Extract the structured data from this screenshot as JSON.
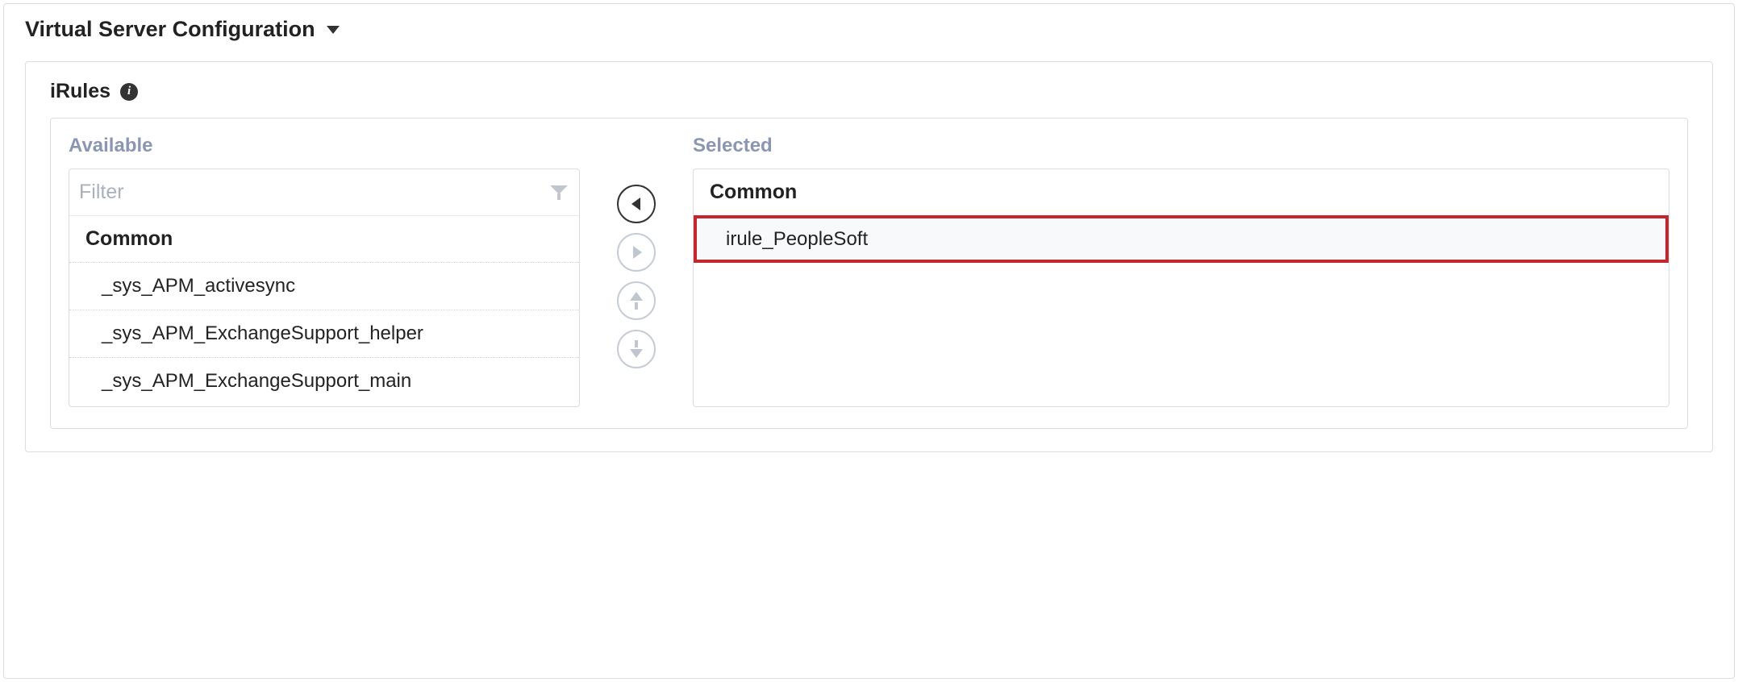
{
  "panel": {
    "title": "Virtual Server Configuration"
  },
  "section": {
    "label": "iRules"
  },
  "dualList": {
    "availableTitle": "Available",
    "selectedTitle": "Selected",
    "filterPlaceholder": "Filter",
    "groupHeader": "Common",
    "availableItems": {
      "0": "_sys_APM_activesync",
      "1": "_sys_APM_ExchangeSupport_helper",
      "2": "_sys_APM_ExchangeSupport_main"
    },
    "selectedItems": {
      "0": "irule_PeopleSoft"
    }
  }
}
